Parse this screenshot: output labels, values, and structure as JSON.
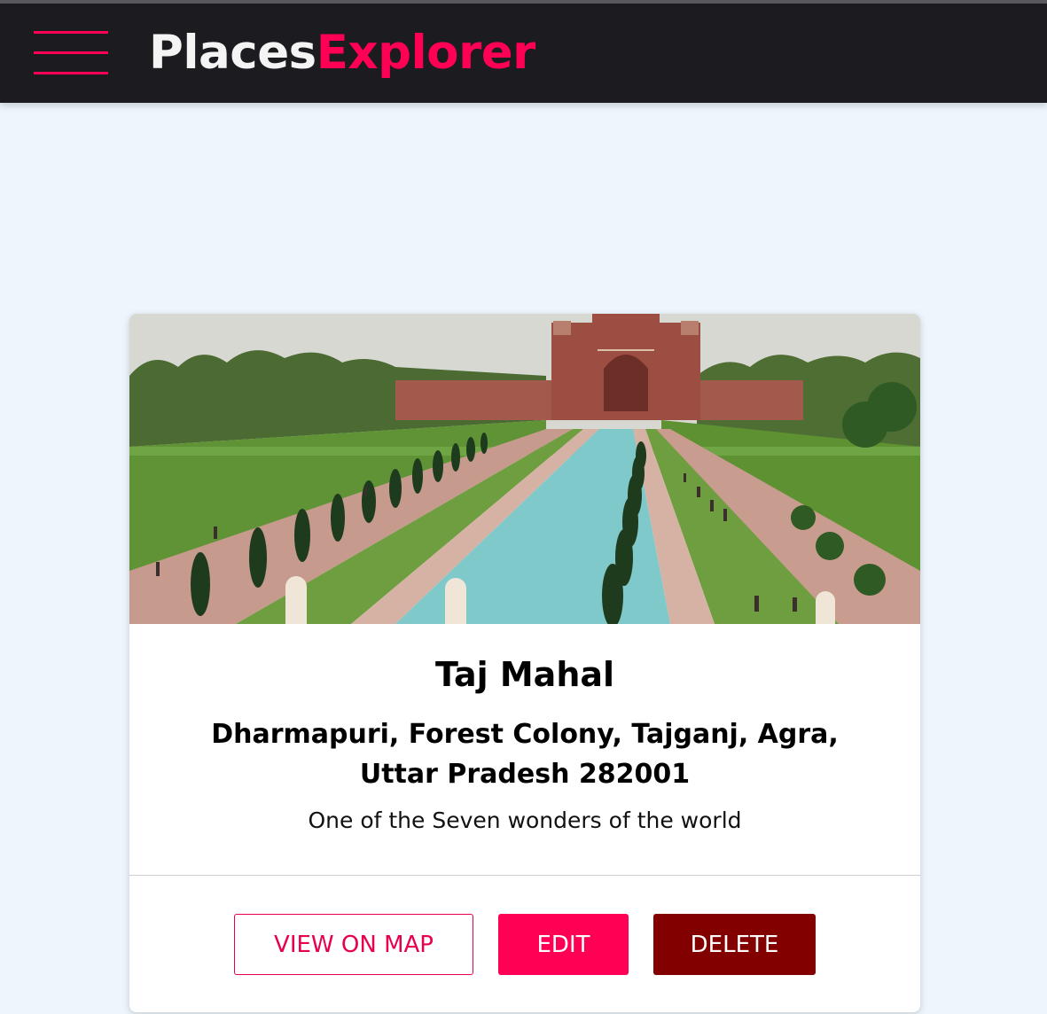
{
  "header": {
    "brand_part1": "Places",
    "brand_part2": "Explorer",
    "accent_color": "#ff0055",
    "background_color": "#1c1b1f"
  },
  "place": {
    "image_alt": "Taj Mahal",
    "title": "Taj Mahal",
    "address": "Dharmapuri, Forest Colony, Tajganj, Agra, Uttar Pradesh 282001",
    "description": "One of the Seven wonders of the world"
  },
  "actions": {
    "view_on_map_label": "VIEW ON MAP",
    "edit_label": "EDIT",
    "delete_label": "DELETE"
  },
  "colors": {
    "page_background": "#eef5fd",
    "delete_color": "#830000"
  }
}
